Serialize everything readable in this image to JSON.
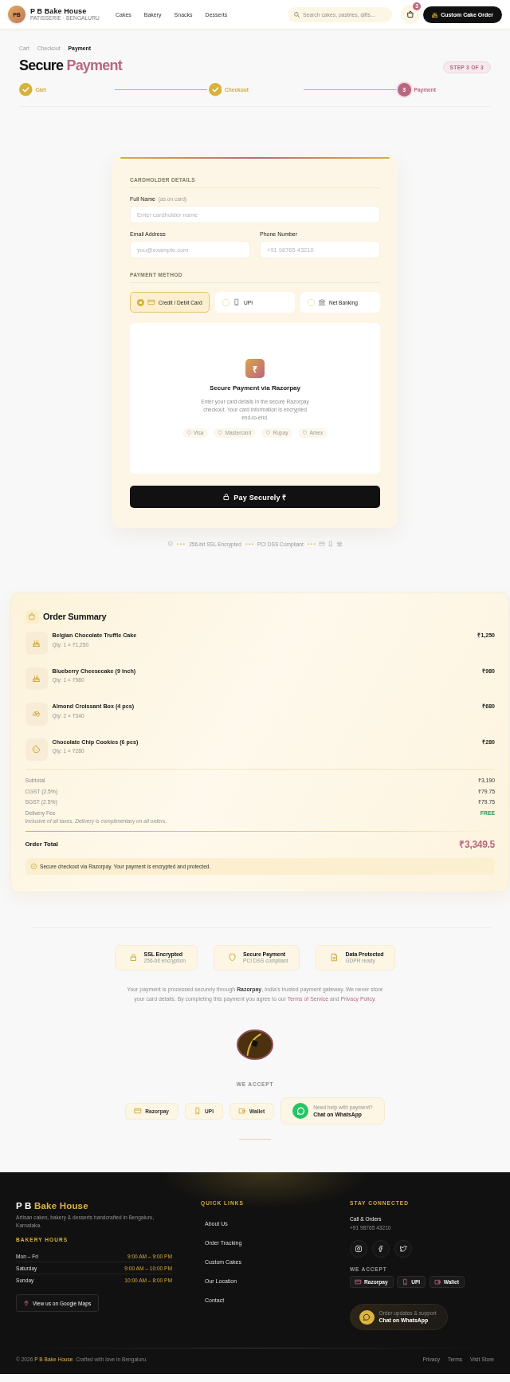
{
  "header": {
    "logo_initials": "PB",
    "brand": "P B Bake House",
    "tagline": "PATISSERIE · BENGALURU",
    "nav": [
      "Cakes",
      "Bakery",
      "Snacks",
      "Desserts"
    ],
    "search": {
      "placeholder": "Search cakes, pastries, gifts..."
    },
    "cart_count": "3",
    "cta": "Custom Cake Order"
  },
  "breadcrumb": [
    {
      "label": "Cart",
      "current": false
    },
    {
      "label": "Checkout",
      "current": false
    },
    {
      "label": "Payment",
      "current": true
    }
  ],
  "title": {
    "plain": "Secure",
    "accent": "Payment"
  },
  "step_badge": "STEP 3 OF 3",
  "steps": [
    {
      "label": "Cart",
      "completed": true
    },
    {
      "label": "Checkout",
      "completed": true
    },
    {
      "label": "Payment",
      "completed": false,
      "number": "3"
    }
  ],
  "payment_form": {
    "cardholder_heading": "CARDHOLDER DETAILS",
    "full_name": {
      "label": "Full Name",
      "hint": "(as on card)",
      "placeholder": "Enter cardholder name"
    },
    "email": {
      "label": "Email Address",
      "placeholder": "you@example.com"
    },
    "phone": {
      "label": "Phone Number",
      "placeholder": "+91 98765 43210"
    },
    "method_heading": "PAYMENT METHOD",
    "methods": [
      {
        "label": "Credit / Debit Card",
        "kind": "card",
        "selected": true
      },
      {
        "label": "UPI",
        "kind": "upi",
        "selected": false
      },
      {
        "label": "Net Banking",
        "kind": "netbanking",
        "selected": false
      }
    ],
    "razorpay": {
      "symbol": "₹",
      "title": "Secure Payment via Razorpay",
      "description": "Enter your card details in the secure Razorpay checkout. Your card information is encrypted end-to-end.",
      "networks": [
        "Visa",
        "Mastercard",
        "Rupay",
        "Amex"
      ]
    },
    "pay_button": "Pay Securely ₹"
  },
  "trust_line": [
    "256-bit SSL Encrypted",
    "PCI DSS Compliant"
  ],
  "order_summary": {
    "title": "Order Summary",
    "items": [
      {
        "name": "Belgian Chocolate Truffle Cake",
        "qty": "Qty: 1 × ₹1,250",
        "price": "₹1,250",
        "kind": "cake"
      },
      {
        "name": "Blueberry Cheesecake (9 inch)",
        "qty": "Qty: 1 × ₹980",
        "price": "₹980",
        "kind": "cake"
      },
      {
        "name": "Almond Croissant Box (4 pcs)",
        "qty": "Qty: 2 × ₹340",
        "price": "₹680",
        "kind": "croissant"
      },
      {
        "name": "Chocolate Chip Cookies (6 pcs)",
        "qty": "Qty: 1 × ₹280",
        "price": "₹280",
        "kind": "cookie"
      }
    ],
    "totals": [
      {
        "label": "Subtotal",
        "value": "₹3,190",
        "kind": "amount"
      },
      {
        "label": "CGST (2.5%)",
        "value": "₹79.75",
        "kind": "amount"
      },
      {
        "label": "SGST (2.5%)",
        "value": "₹79.75",
        "kind": "amount"
      },
      {
        "label": "Delivery Fee",
        "value": "FREE",
        "kind": "free"
      }
    ],
    "tax_note": "Inclusive of all taxes. Delivery is complimentary on all orders.",
    "total_label": "Order Total",
    "total_value": "₹3,349.5",
    "secure_note": "Secure checkout via Razorpay. Your payment is encrypted and protected."
  },
  "assurance": {
    "badges": [
      {
        "title": "SSL Encrypted",
        "subtitle": "256-bit encryption",
        "kind": "ssl"
      },
      {
        "title": "Secure Payment",
        "subtitle": "PCI DSS compliant",
        "kind": "payment"
      },
      {
        "title": "Data Protected",
        "subtitle": "GDPR ready",
        "kind": "privacy"
      }
    ],
    "paragraph": {
      "text": "Your payment is processed securely through **Razorpay**, India's trusted payment gateway. We never store your card details. By completing this payment you agree to our",
      "terms_link": "Terms of Service",
      "joiner": "and",
      "privacy_link": "Privacy Policy",
      "end": "."
    },
    "accept_heading": "WE ACCEPT",
    "accept": [
      {
        "label": "Razorpay",
        "kind": "razorpay"
      },
      {
        "label": "UPI",
        "kind": "upi"
      },
      {
        "label": "Wallet",
        "kind": "wallet"
      }
    ],
    "whatsapp": {
      "hint": "Need help with payment?",
      "label": "Chat on WhatsApp"
    }
  },
  "footer": {
    "brand_plain": "P B",
    "brand_accent": "Bake House",
    "description": "Artisan cakes, bakery & desserts handcrafted in Bengaluru, Karnataka.",
    "hours_heading": "BAKERY HOURS",
    "hours": [
      {
        "day": "Mon – Fri",
        "time": "9:00 AM – 9:00 PM"
      },
      {
        "day": "Saturday",
        "time": "9:00 AM – 10:00 PM"
      },
      {
        "day": "Sunday",
        "time": "10:00 AM – 8:00 PM"
      }
    ],
    "maps_button": "View us on Google Maps",
    "links_heading": "QUICK LINKS",
    "links": [
      "About Us",
      "Order Tracking",
      "Custom Cakes",
      "Our Location",
      "Contact"
    ],
    "connect_heading": "STAY CONNECTED",
    "contact_label": "Call & Orders",
    "phone": "+91 98765 43210",
    "accept_heading": "WE ACCEPT",
    "accept": [
      {
        "label": "Razorpay",
        "kind": "razorpay"
      },
      {
        "label": "UPI",
        "kind": "upi"
      },
      {
        "label": "Wallet",
        "kind": "wallet"
      }
    ],
    "whatsapp": {
      "hint": "Order updates & support",
      "label": "Chat on WhatsApp"
    },
    "copyright": {
      "prefix": "© 2026",
      "brand": "P B Bake House",
      "suffix": ". Crafted with love in Bengaluru."
    },
    "bottom_links": [
      "Privacy",
      "Terms",
      "Visit Store"
    ]
  }
}
